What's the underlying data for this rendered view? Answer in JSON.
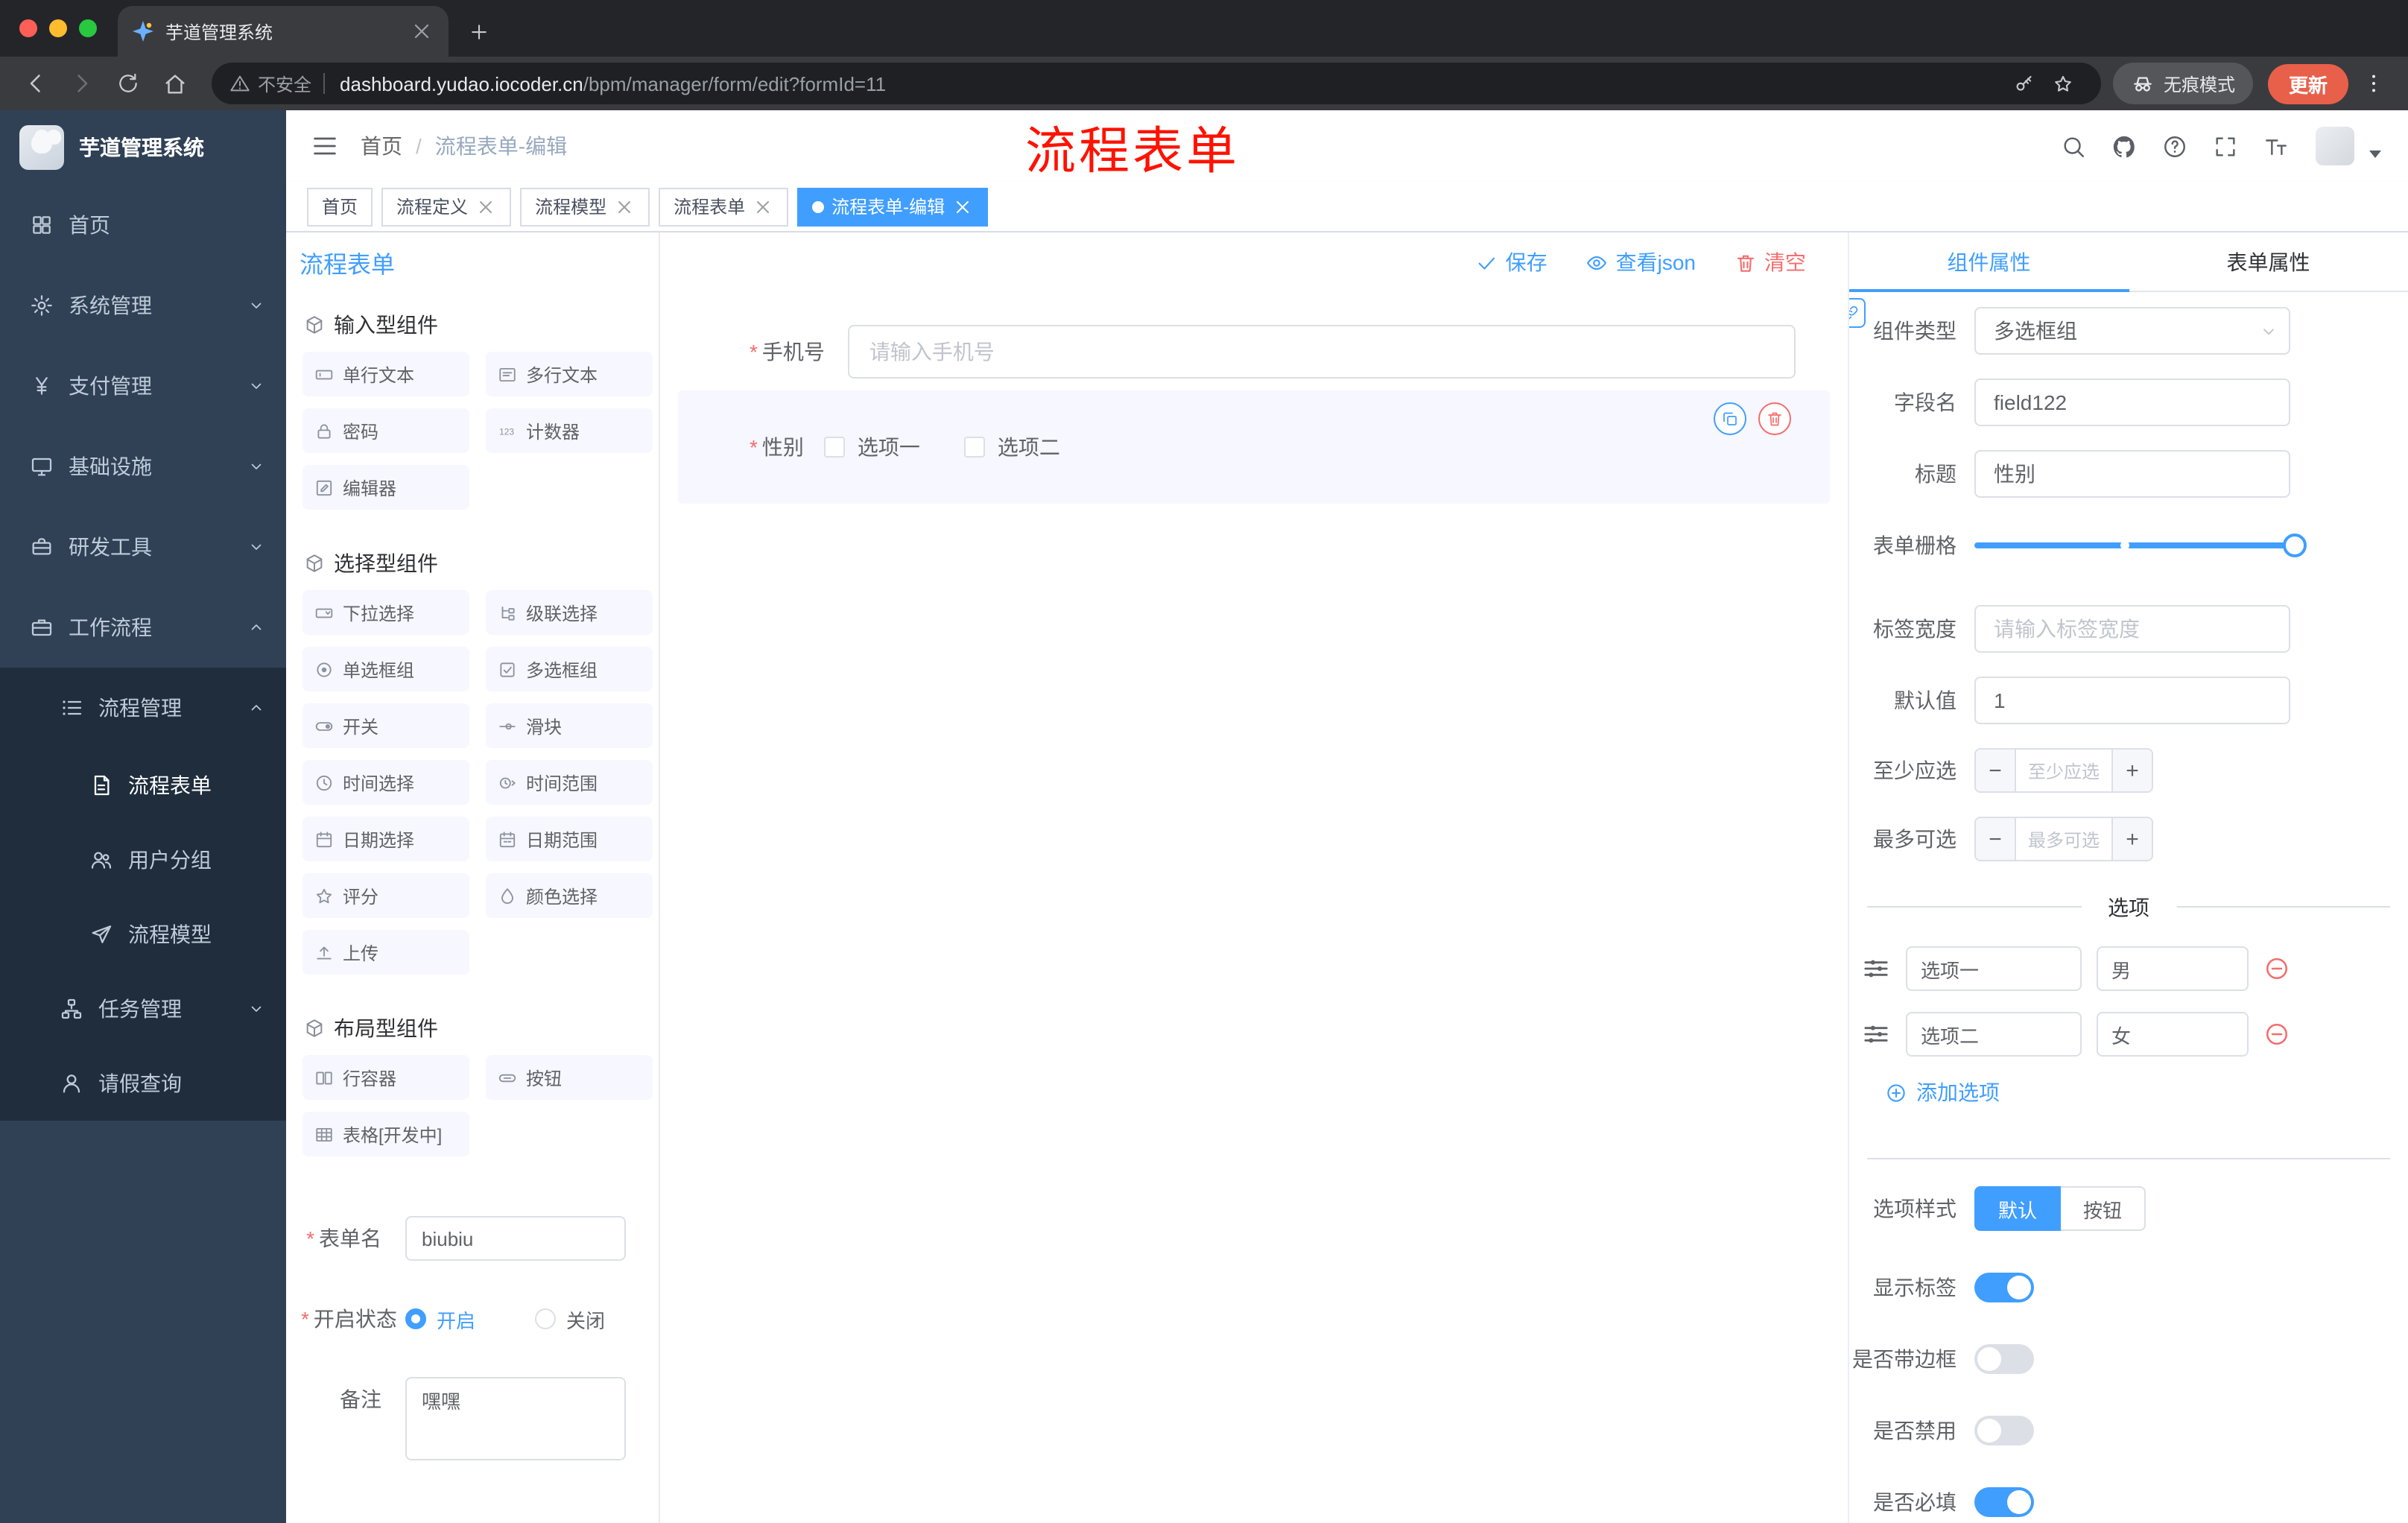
{
  "browser": {
    "tab_title": "芋道管理系统",
    "security_label": "不安全",
    "url_domain": "dashboard.yudao.iocoder.cn",
    "url_path": "/bpm/manager/form/edit?formId=11",
    "incognito_label": "无痕模式",
    "update_label": "更新"
  },
  "sidebar": {
    "logo_title": "芋道管理系统",
    "items": [
      {
        "label": "首页"
      },
      {
        "label": "系统管理"
      },
      {
        "label": "支付管理"
      },
      {
        "label": "基础设施"
      },
      {
        "label": "研发工具"
      },
      {
        "label": "工作流程"
      },
      {
        "label": "流程管理"
      },
      {
        "label": "流程表单"
      },
      {
        "label": "用户分组"
      },
      {
        "label": "流程模型"
      },
      {
        "label": "任务管理"
      },
      {
        "label": "请假查询"
      }
    ]
  },
  "header": {
    "breadcrumb_home": "首页",
    "breadcrumb_current": "流程表单-编辑",
    "annotation": "流程表单"
  },
  "tags": [
    {
      "label": "首页"
    },
    {
      "label": "流程定义"
    },
    {
      "label": "流程模型"
    },
    {
      "label": "流程表单"
    },
    {
      "label": "流程表单-编辑"
    }
  ],
  "designer": {
    "title": "流程表单",
    "actions": {
      "save": "保存",
      "view_json": "查看json",
      "clear": "清空"
    },
    "palette": {
      "section_input": "输入型组件",
      "section_select": "选择型组件",
      "section_layout": "布局型组件",
      "input_items": [
        "单行文本",
        "多行文本",
        "密码",
        "计数器",
        "编辑器"
      ],
      "select_items": [
        "下拉选择",
        "级联选择",
        "单选框组",
        "多选框组",
        "开关",
        "滑块",
        "时间选择",
        "时间范围",
        "日期选择",
        "日期范围",
        "评分",
        "颜色选择",
        "上传"
      ],
      "layout_items": [
        "行容器",
        "按钮",
        "表格[开发中]"
      ]
    },
    "form_meta": {
      "name_label": "表单名",
      "name_value": "biubiu",
      "status_label": "开启状态",
      "status_on": "开启",
      "status_off": "关闭",
      "remark_label": "备注",
      "remark_value": "嘿嘿"
    },
    "canvas": {
      "phone_label": "手机号",
      "phone_placeholder": "请输入手机号",
      "gender_label": "性别",
      "gender_opt1": "选项一",
      "gender_opt2": "选项二"
    },
    "props": {
      "tab_component": "组件属性",
      "tab_form": "表单属性",
      "component_type_label": "组件类型",
      "component_type_value": "多选框组",
      "field_name_label": "字段名",
      "field_name_value": "field122",
      "title_label": "标题",
      "title_value": "性别",
      "grid_label": "表单栅格",
      "tag_width_label": "标签宽度",
      "tag_width_placeholder": "请输入标签宽度",
      "default_label": "默认值",
      "default_value": "1",
      "min_label": "至少应选",
      "min_placeholder": "至少应选",
      "max_label": "最多可选",
      "max_placeholder": "最多可选",
      "options_title": "选项",
      "options": [
        {
          "label": "选项一",
          "value": "男"
        },
        {
          "label": "选项二",
          "value": "女"
        }
      ],
      "add_option": "添加选项",
      "style_label": "选项样式",
      "style_default": "默认",
      "style_button": "按钮",
      "show_label_label": "显示标签",
      "border_label": "是否带边框",
      "disabled_label": "是否禁用",
      "required_label": "是否必填"
    }
  },
  "colors": {
    "primary": "#409eff",
    "danger": "#f56c6c",
    "annotation_red": "#fe1200",
    "sidebar_bg": "#304156",
    "submenu_bg": "#1f2d3d"
  },
  "icons": {
    "security": "warning-triangle",
    "incognito": "hat-and-glasses",
    "browser_menu": "vertical-dots",
    "search": "magnifier",
    "repo": "github-mark",
    "docs": "question-circle",
    "fullscreen": "corner-brackets",
    "font_size": "double-T",
    "save": "check",
    "view_json": "eye",
    "clear": "trash",
    "widget_copy": "overlap-squares",
    "widget_delete": "trash",
    "option_drag": "slider-lines",
    "option_remove": "minus-circle",
    "option_add": "plus-circle",
    "props_link": "chain-link"
  }
}
